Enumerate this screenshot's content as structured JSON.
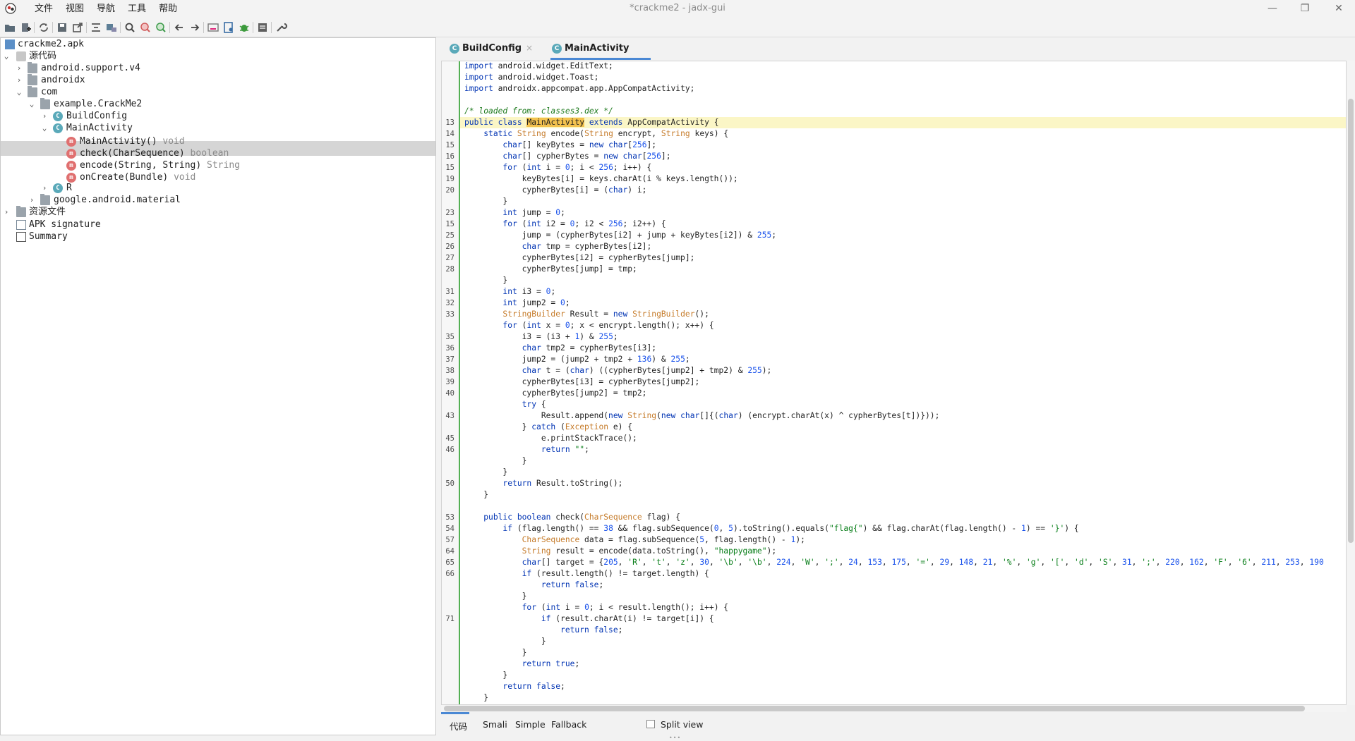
{
  "window": {
    "title": "*crackme2 - jadx-gui",
    "minimize": "—",
    "maximize": "❐",
    "close": "✕"
  },
  "menu": [
    "文件",
    "视图",
    "导航",
    "工具",
    "帮助"
  ],
  "toolbar_icons": [
    "open-file-icon",
    "add-files-icon",
    "sync-icon",
    "save-icon",
    "export-icon",
    "decompile-icon",
    "class-browser-icon",
    "search-icon",
    "find-usage-icon",
    "search-text-icon",
    "back-icon",
    "forward-icon",
    "deobfuscation-icon",
    "quark-icon",
    "debug-icon",
    "log-icon",
    "preferences-icon"
  ],
  "tree": {
    "root": "crackme2.apk",
    "source": "源代码",
    "pkg1": "android.support.v4",
    "pkg2": "androidx",
    "pkg3": "com",
    "pkg4": "example.CrackMe2",
    "cls1": "BuildConfig",
    "cls2": "MainActivity",
    "m1": "MainActivity()",
    "m1_ret": "void",
    "m2": "check(CharSequence)",
    "m2_ret": "boolean",
    "m3": "encode(String, String)",
    "m3_ret": "String",
    "m4": "onCreate(Bundle)",
    "m4_ret": "void",
    "cls3": "R",
    "pkg5": "google.android.material",
    "resources": "资源文件",
    "apk_sig": "APK signature",
    "summary": "Summary"
  },
  "tabs": {
    "tab1": "BuildConfig",
    "tab2": "MainActivity",
    "close": "×"
  },
  "bottom": {
    "code": "代码",
    "smali": "Smali",
    "simple": "Simple",
    "fallback": "Fallback",
    "split": "Split view"
  },
  "code_lines": [
    {
      "n": "",
      "t": "<span class=\"kw\">import</span> android.widget.EditText;"
    },
    {
      "n": "",
      "t": "<span class=\"kw\">import</span> android.widget.Toast;"
    },
    {
      "n": "",
      "t": "<span class=\"kw\">import</span> androidx.appcompat.app.AppCompatActivity;"
    },
    {
      "n": "",
      "t": ""
    },
    {
      "n": "",
      "t": "<span class=\"cm\">/* loaded from: classes3.dex */</span>"
    },
    {
      "n": "13",
      "t": "<span class=\"kw\">public class</span> <span class=\"hlname\">MainActivity</span> <span class=\"kw\">extends</span> AppCompatActivity {"
    },
    {
      "n": "14",
      "t": "    <span class=\"kw\">static</span> <span class=\"ty\">String</span> encode(<span class=\"ty\">String</span> encrypt, <span class=\"ty\">String</span> keys) {"
    },
    {
      "n": "15",
      "t": "        <span class=\"kw\">char</span>[] keyBytes = <span class=\"kw\">new char</span>[<span class=\"nm\">256</span>];"
    },
    {
      "n": "16",
      "t": "        <span class=\"kw\">char</span>[] cypherBytes = <span class=\"kw\">new char</span>[<span class=\"nm\">256</span>];"
    },
    {
      "n": "15",
      "t": "        <span class=\"kw\">for</span> (<span class=\"kw\">int</span> i = <span class=\"nm\">0</span>; i &lt; <span class=\"nm\">256</span>; i++) {"
    },
    {
      "n": "19",
      "t": "            keyBytes[i] = keys.charAt(i % keys.length());"
    },
    {
      "n": "20",
      "t": "            cypherBytes[i] = (<span class=\"kw\">char</span>) i;"
    },
    {
      "n": "",
      "t": "        }"
    },
    {
      "n": "23",
      "t": "        <span class=\"kw\">int</span> jump = <span class=\"nm\">0</span>;"
    },
    {
      "n": "15",
      "t": "        <span class=\"kw\">for</span> (<span class=\"kw\">int</span> i2 = <span class=\"nm\">0</span>; i2 &lt; <span class=\"nm\">256</span>; i2++) {"
    },
    {
      "n": "25",
      "t": "            jump = (cypherBytes[i2] + jump + keyBytes[i2]) &amp; <span class=\"nm\">255</span>;"
    },
    {
      "n": "26",
      "t": "            <span class=\"kw\">char</span> tmp = cypherBytes[i2];"
    },
    {
      "n": "27",
      "t": "            cypherBytes[i2] = cypherBytes[jump];"
    },
    {
      "n": "28",
      "t": "            cypherBytes[jump] = tmp;"
    },
    {
      "n": "",
      "t": "        }"
    },
    {
      "n": "31",
      "t": "        <span class=\"kw\">int</span> i3 = <span class=\"nm\">0</span>;"
    },
    {
      "n": "32",
      "t": "        <span class=\"kw\">int</span> jump2 = <span class=\"nm\">0</span>;"
    },
    {
      "n": "33",
      "t": "        <span class=\"ty\">StringBuilder</span> Result = <span class=\"kw\">new</span> <span class=\"ty\">StringBuilder</span>();"
    },
    {
      "n": "",
      "t": "        <span class=\"kw\">for</span> (<span class=\"kw\">int</span> x = <span class=\"nm\">0</span>; x &lt; encrypt.length(); x++) {"
    },
    {
      "n": "35",
      "t": "            i3 = (i3 + <span class=\"nm\">1</span>) &amp; <span class=\"nm\">255</span>;"
    },
    {
      "n": "36",
      "t": "            <span class=\"kw\">char</span> tmp2 = cypherBytes[i3];"
    },
    {
      "n": "37",
      "t": "            jump2 = (jump2 + tmp2 + <span class=\"nm\">136</span>) &amp; <span class=\"nm\">255</span>;"
    },
    {
      "n": "38",
      "t": "            <span class=\"kw\">char</span> t = (<span class=\"kw\">char</span>) ((cypherBytes[jump2] + tmp2) &amp; <span class=\"nm\">255</span>);"
    },
    {
      "n": "39",
      "t": "            cypherBytes[i3] = cypherBytes[jump2];"
    },
    {
      "n": "40",
      "t": "            cypherBytes[jump2] = tmp2;"
    },
    {
      "n": "",
      "t": "            <span class=\"kw\">try</span> {"
    },
    {
      "n": "43",
      "t": "                Result.append(<span class=\"kw\">new</span> <span class=\"ty\">String</span>(<span class=\"kw\">new char</span>[]{(<span class=\"kw\">char</span>) (encrypt.charAt(x) ^ cypherBytes[t])}));"
    },
    {
      "n": "",
      "t": "            } <span class=\"kw\">catch</span> (<span class=\"ty\">Exception</span> e) {"
    },
    {
      "n": "45",
      "t": "                e.printStackTrace();"
    },
    {
      "n": "46",
      "t": "                <span class=\"kw\">return</span> <span class=\"st\">\"\"</span>;"
    },
    {
      "n": "",
      "t": "            }"
    },
    {
      "n": "",
      "t": "        }"
    },
    {
      "n": "50",
      "t": "        <span class=\"kw\">return</span> Result.toString();"
    },
    {
      "n": "",
      "t": "    }"
    },
    {
      "n": "",
      "t": ""
    },
    {
      "n": "53",
      "t": "    <span class=\"kw\">public boolean</span> check(<span class=\"ty\">CharSequence</span> flag) {"
    },
    {
      "n": "54",
      "t": "        <span class=\"kw\">if</span> (flag.length() == <span class=\"nm\">38</span> &amp;&amp; flag.subSequence(<span class=\"nm\">0</span>, <span class=\"nm\">5</span>).toString().equals(<span class=\"st\">\"flag{\"</span>) &amp;&amp; flag.charAt(flag.length() - <span class=\"nm\">1</span>) == <span class=\"st\">'}'</span>) {"
    },
    {
      "n": "57",
      "t": "            <span class=\"ty\">CharSequence</span> data = flag.subSequence(<span class=\"nm\">5</span>, flag.length() - <span class=\"nm\">1</span>);"
    },
    {
      "n": "64",
      "t": "            <span class=\"ty\">String</span> result = encode(data.toString(), <span class=\"st\">\"happygame\"</span>);"
    },
    {
      "n": "65",
      "t": "            <span class=\"kw\">char</span>[] target = {<span class=\"nm\">205</span>, <span class=\"st\">'R'</span>, <span class=\"st\">'t'</span>, <span class=\"st\">'z'</span>, <span class=\"nm\">30</span>, <span class=\"st\">'\\b'</span>, <span class=\"st\">'\\b'</span>, <span class=\"nm\">224</span>, <span class=\"st\">'W'</span>, <span class=\"st\">';'</span>, <span class=\"nm\">24</span>, <span class=\"nm\">153</span>, <span class=\"nm\">175</span>, <span class=\"st\">'='</span>, <span class=\"nm\">29</span>, <span class=\"nm\">148</span>, <span class=\"nm\">21</span>, <span class=\"st\">'%'</span>, <span class=\"st\">'g'</span>, <span class=\"st\">'['</span>, <span class=\"st\">'d'</span>, <span class=\"st\">'S'</span>, <span class=\"nm\">31</span>, <span class=\"st\">';'</span>, <span class=\"nm\">220</span>, <span class=\"nm\">162</span>, <span class=\"st\">'F'</span>, <span class=\"st\">'6'</span>, <span class=\"nm\">211</span>, <span class=\"nm\">253</span>, <span class=\"nm\">190</span>"
    },
    {
      "n": "66",
      "t": "            <span class=\"kw\">if</span> (result.length() != target.length) {"
    },
    {
      "n": "",
      "t": "                <span class=\"kw\">return false</span>;"
    },
    {
      "n": "",
      "t": "            }"
    },
    {
      "n": "",
      "t": "            <span class=\"kw\">for</span> (<span class=\"kw\">int</span> i = <span class=\"nm\">0</span>; i &lt; result.length(); i++) {"
    },
    {
      "n": "71",
      "t": "                <span class=\"kw\">if</span> (result.charAt(i) != target[i]) {"
    },
    {
      "n": "",
      "t": "                    <span class=\"kw\">return false</span>;"
    },
    {
      "n": "",
      "t": "                }"
    },
    {
      "n": "",
      "t": "            }"
    },
    {
      "n": "",
      "t": "            <span class=\"kw\">return true</span>;"
    },
    {
      "n": "",
      "t": "        }"
    },
    {
      "n": "",
      "t": "        <span class=\"kw\">return false</span>;"
    },
    {
      "n": "",
      "t": "    }"
    }
  ]
}
